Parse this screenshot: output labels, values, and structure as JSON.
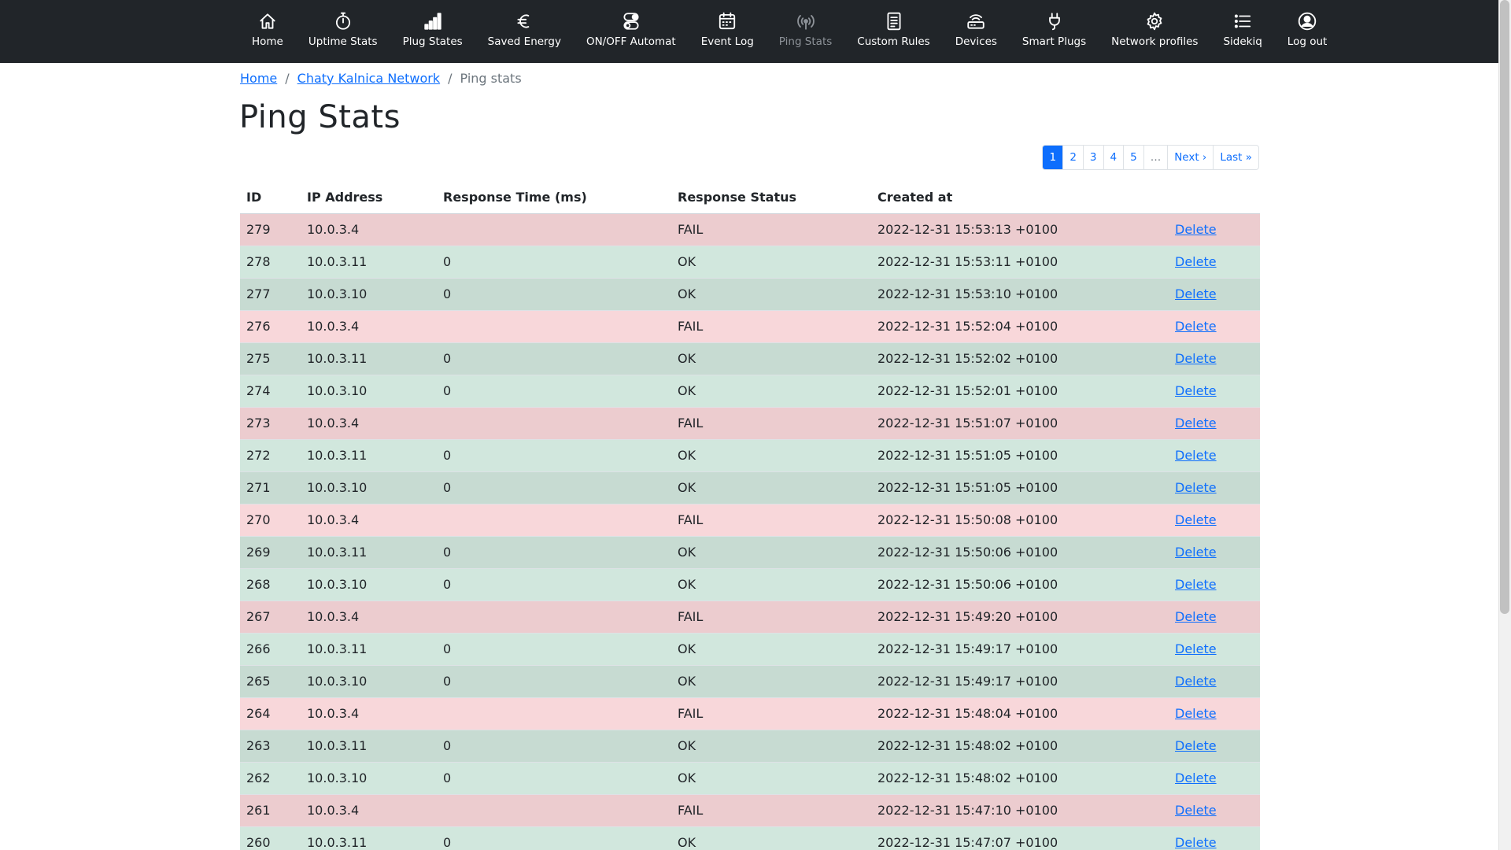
{
  "nav": [
    {
      "label": "Home",
      "icon": "home-icon"
    },
    {
      "label": "Uptime Stats",
      "icon": "stopwatch-icon"
    },
    {
      "label": "Plug States",
      "icon": "signal-bars-icon"
    },
    {
      "label": "Saved Energy",
      "icon": "euro-icon"
    },
    {
      "label": "ON/OFF Automat",
      "icon": "toggles-icon"
    },
    {
      "label": "Event Log",
      "icon": "calendar-icon"
    },
    {
      "label": "Ping Stats",
      "icon": "broadcast-icon",
      "active": true
    },
    {
      "label": "Custom Rules",
      "icon": "document-icon"
    },
    {
      "label": "Devices",
      "icon": "router-icon"
    },
    {
      "label": "Smart Plugs",
      "icon": "plug-icon"
    },
    {
      "label": "Network profiles",
      "icon": "gear-icon"
    },
    {
      "label": "Sidekiq",
      "icon": "list-icon"
    },
    {
      "label": "Log out",
      "icon": "user-circle-icon"
    }
  ],
  "breadcrumb": {
    "home": "Home",
    "network": "Chaty Kalnica Network",
    "current": "Ping stats",
    "separator": "/"
  },
  "page_title": "Ping Stats",
  "pagination": {
    "pages": [
      "1",
      "2",
      "3",
      "4",
      "5"
    ],
    "current": "1",
    "ellipsis": "…",
    "next": "Next ›",
    "last": "Last »"
  },
  "table": {
    "headers": [
      "ID",
      "IP Address",
      "Response Time (ms)",
      "Response Status",
      "Created at",
      ""
    ],
    "delete_label": "Delete",
    "rows": [
      {
        "id": "279",
        "ip": "10.0.3.4",
        "time": "",
        "status": "FAIL",
        "created": "2022-12-31 15:53:13 +0100"
      },
      {
        "id": "278",
        "ip": "10.0.3.11",
        "time": "0",
        "status": "OK",
        "created": "2022-12-31 15:53:11 +0100"
      },
      {
        "id": "277",
        "ip": "10.0.3.10",
        "time": "0",
        "status": "OK",
        "created": "2022-12-31 15:53:10 +0100"
      },
      {
        "id": "276",
        "ip": "10.0.3.4",
        "time": "",
        "status": "FAIL",
        "created": "2022-12-31 15:52:04 +0100"
      },
      {
        "id": "275",
        "ip": "10.0.3.11",
        "time": "0",
        "status": "OK",
        "created": "2022-12-31 15:52:02 +0100"
      },
      {
        "id": "274",
        "ip": "10.0.3.10",
        "time": "0",
        "status": "OK",
        "created": "2022-12-31 15:52:01 +0100"
      },
      {
        "id": "273",
        "ip": "10.0.3.4",
        "time": "",
        "status": "FAIL",
        "created": "2022-12-31 15:51:07 +0100"
      },
      {
        "id": "272",
        "ip": "10.0.3.11",
        "time": "0",
        "status": "OK",
        "created": "2022-12-31 15:51:05 +0100"
      },
      {
        "id": "271",
        "ip": "10.0.3.10",
        "time": "0",
        "status": "OK",
        "created": "2022-12-31 15:51:05 +0100"
      },
      {
        "id": "270",
        "ip": "10.0.3.4",
        "time": "",
        "status": "FAIL",
        "created": "2022-12-31 15:50:08 +0100"
      },
      {
        "id": "269",
        "ip": "10.0.3.11",
        "time": "0",
        "status": "OK",
        "created": "2022-12-31 15:50:06 +0100"
      },
      {
        "id": "268",
        "ip": "10.0.3.10",
        "time": "0",
        "status": "OK",
        "created": "2022-12-31 15:50:06 +0100"
      },
      {
        "id": "267",
        "ip": "10.0.3.4",
        "time": "",
        "status": "FAIL",
        "created": "2022-12-31 15:49:20 +0100"
      },
      {
        "id": "266",
        "ip": "10.0.3.11",
        "time": "0",
        "status": "OK",
        "created": "2022-12-31 15:49:17 +0100"
      },
      {
        "id": "265",
        "ip": "10.0.3.10",
        "time": "0",
        "status": "OK",
        "created": "2022-12-31 15:49:17 +0100"
      },
      {
        "id": "264",
        "ip": "10.0.3.4",
        "time": "",
        "status": "FAIL",
        "created": "2022-12-31 15:48:04 +0100"
      },
      {
        "id": "263",
        "ip": "10.0.3.11",
        "time": "0",
        "status": "OK",
        "created": "2022-12-31 15:48:02 +0100"
      },
      {
        "id": "262",
        "ip": "10.0.3.10",
        "time": "0",
        "status": "OK",
        "created": "2022-12-31 15:48:02 +0100"
      },
      {
        "id": "261",
        "ip": "10.0.3.4",
        "time": "",
        "status": "FAIL",
        "created": "2022-12-31 15:47:10 +0100"
      },
      {
        "id": "260",
        "ip": "10.0.3.11",
        "time": "0",
        "status": "OK",
        "created": "2022-12-31 15:47:07 +0100"
      }
    ]
  },
  "colors": {
    "navbar": "#212529",
    "link": "#0d6efd",
    "fail_row": "#f8d7da",
    "ok_row": "#d1e7dd"
  }
}
